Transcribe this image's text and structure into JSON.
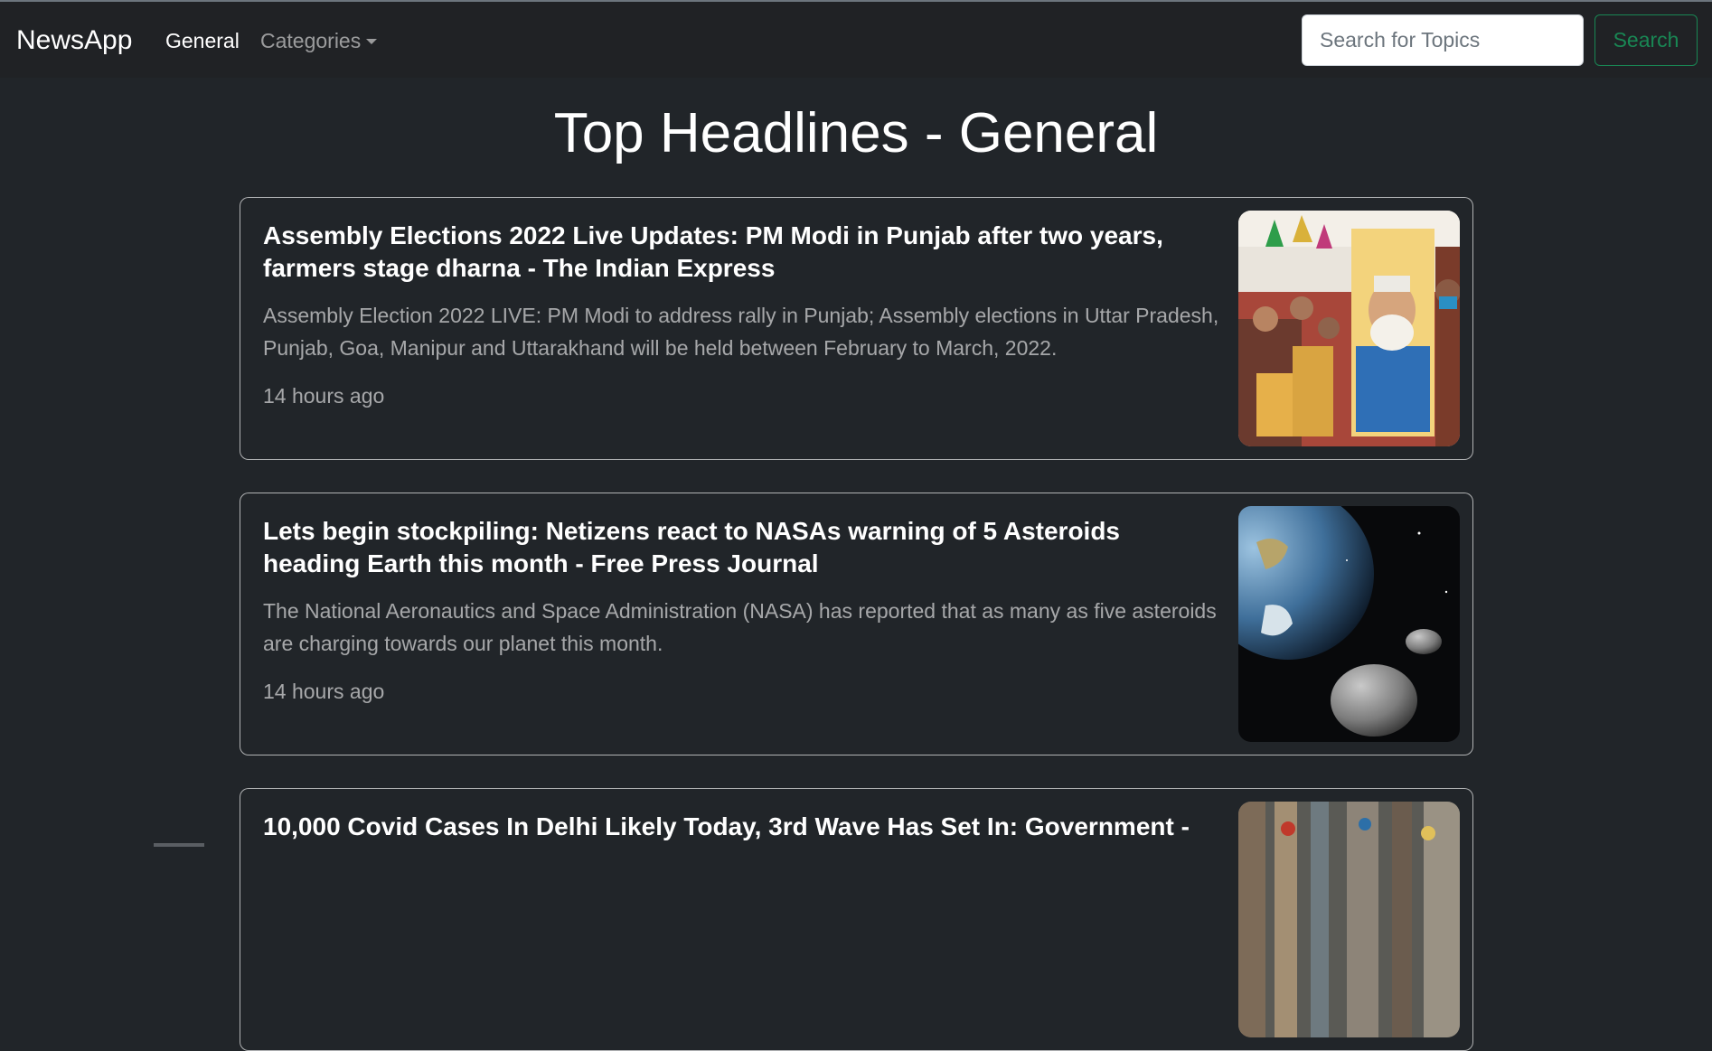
{
  "nav": {
    "brand": "NewsApp",
    "general": "General",
    "categories": "Categories",
    "categories_icon": "caret-down-icon",
    "search_placeholder": "Search for Topics",
    "search_button": "Search"
  },
  "page_title": "Top Headlines - General",
  "articles": [
    {
      "title": "Assembly Elections 2022 Live Updates: PM Modi in Punjab after two years, farmers stage dharna - The Indian Express",
      "description": "Assembly Election 2022 LIVE: PM Modi to address rally in Punjab; Assembly elections in Uttar Pradesh, Punjab, Goa, Manipur and Uttarakhand will be held between February to March, 2022.",
      "time": "14 hours ago",
      "image": "rally-crowd-with-modi-poster"
    },
    {
      "title": "Lets begin stockpiling: Netizens react to NASAs warning of 5 Asteroids heading Earth this month - Free Press Journal",
      "description": "The National Aeronautics and Space Administration (NASA) has reported that as many as five asteroids are charging towards our planet this month.",
      "time": "14 hours ago",
      "image": "earth-and-asteroid-in-space"
    },
    {
      "title": "10,000 Covid Cases In Delhi Likely Today, 3rd Wave Has Set In: Government -",
      "image": "crowded-street"
    }
  ],
  "colors": {
    "background": "#212529",
    "navbar": "#202225",
    "success": "#198754"
  }
}
